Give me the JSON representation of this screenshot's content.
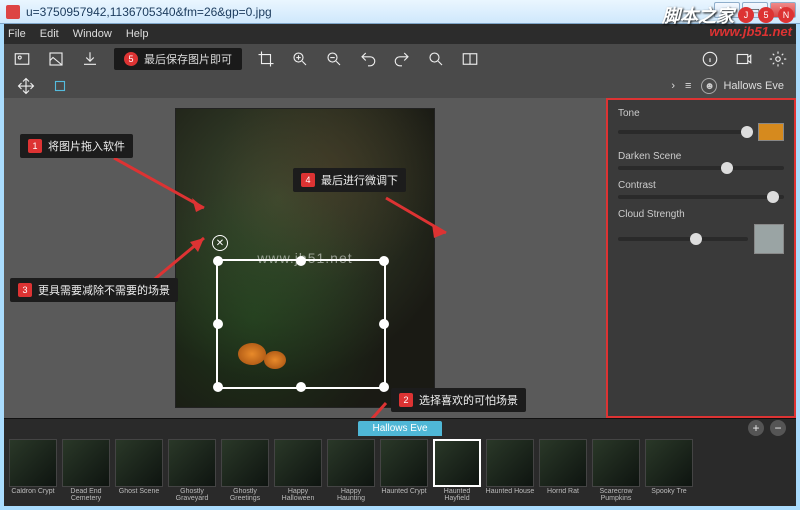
{
  "window": {
    "title": "u=3750957942,1136705340&fm=26&gp=0.jpg"
  },
  "menu": {
    "file": "File",
    "edit": "Edit",
    "window": "Window",
    "help": "Help"
  },
  "toolbar": {
    "tip5_num": "5",
    "tip5_text": "最后保存图片即可"
  },
  "theme_label": "Hallows Eve",
  "panel": {
    "tone": {
      "label": "Tone",
      "value": 92,
      "swatch": "#d68a1e"
    },
    "darken": {
      "label": "Darken Scene",
      "value": 62
    },
    "contrast": {
      "label": "Contrast",
      "value": 90
    },
    "cloud": {
      "label": "Cloud Strength",
      "value": 55,
      "swatch": "#9aa4a4"
    }
  },
  "callouts": {
    "c1": {
      "num": "1",
      "text": "将图片拖入软件"
    },
    "c3": {
      "num": "3",
      "text": "更具需要减除不需要的场景"
    },
    "c4": {
      "num": "4",
      "text": "最后进行微调下"
    },
    "c2": {
      "num": "2",
      "text": "选择喜欢的可怕场景"
    }
  },
  "watermark": "www.jb51.net",
  "presets_tab": "Hallows Eve",
  "presets": [
    {
      "label": "Caldron Crypt"
    },
    {
      "label": "Dead End Cemetery"
    },
    {
      "label": "Ghost Scene"
    },
    {
      "label": "Ghostly Graveyard"
    },
    {
      "label": "Ghostly Greetings"
    },
    {
      "label": "Happy Halloween"
    },
    {
      "label": "Happy Haunting"
    },
    {
      "label": "Haunted Crypt"
    },
    {
      "label": "Haunted Hayfield"
    },
    {
      "label": "Haunted House"
    },
    {
      "label": "Horrid Rat"
    },
    {
      "label": "Scarecrow Pumpkins"
    },
    {
      "label": "Spooky Tre"
    }
  ],
  "selected_preset": 8,
  "sitelogo": {
    "cn": "脚本之家",
    "en": "www.jb51.net"
  }
}
